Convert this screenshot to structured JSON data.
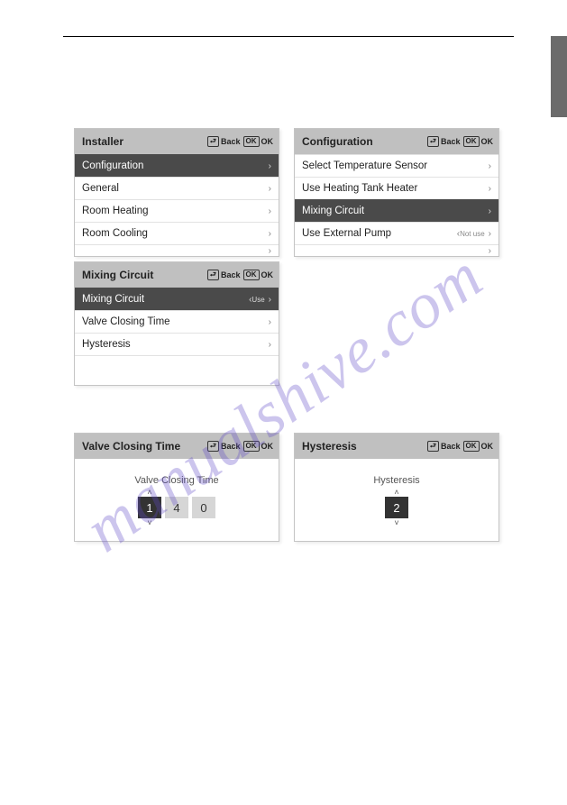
{
  "nav": {
    "back": "Back",
    "ok": "OK"
  },
  "panels": {
    "installer": {
      "title": "Installer",
      "items": [
        {
          "label": "Configuration",
          "selected": true
        },
        {
          "label": "General"
        },
        {
          "label": "Room Heating"
        },
        {
          "label": "Room Cooling"
        },
        {
          "label": "",
          "partial": true
        }
      ]
    },
    "configuration": {
      "title": "Configuration",
      "items": [
        {
          "label": "Select Temperature Sensor"
        },
        {
          "label": "Use Heating Tank Heater"
        },
        {
          "label": "Mixing Circuit",
          "selected": true
        },
        {
          "label": "Use External Pump",
          "tag": "Not use"
        },
        {
          "label": "",
          "partial": true
        }
      ]
    },
    "mixing": {
      "title": "Mixing Circuit",
      "items": [
        {
          "label": "Mixing Circuit",
          "selected": true,
          "tag": "Use"
        },
        {
          "label": "Valve Closing Time"
        },
        {
          "label": "Hysteresis"
        }
      ]
    },
    "valve": {
      "head": "Valve Closing Time",
      "label": "Valve Closing Time",
      "digits": [
        "1",
        "4",
        "0"
      ]
    },
    "hyst": {
      "head": "Hysteresis",
      "label": "Hysteresis",
      "digits": [
        "2"
      ]
    }
  },
  "watermark": "manualshive.com"
}
